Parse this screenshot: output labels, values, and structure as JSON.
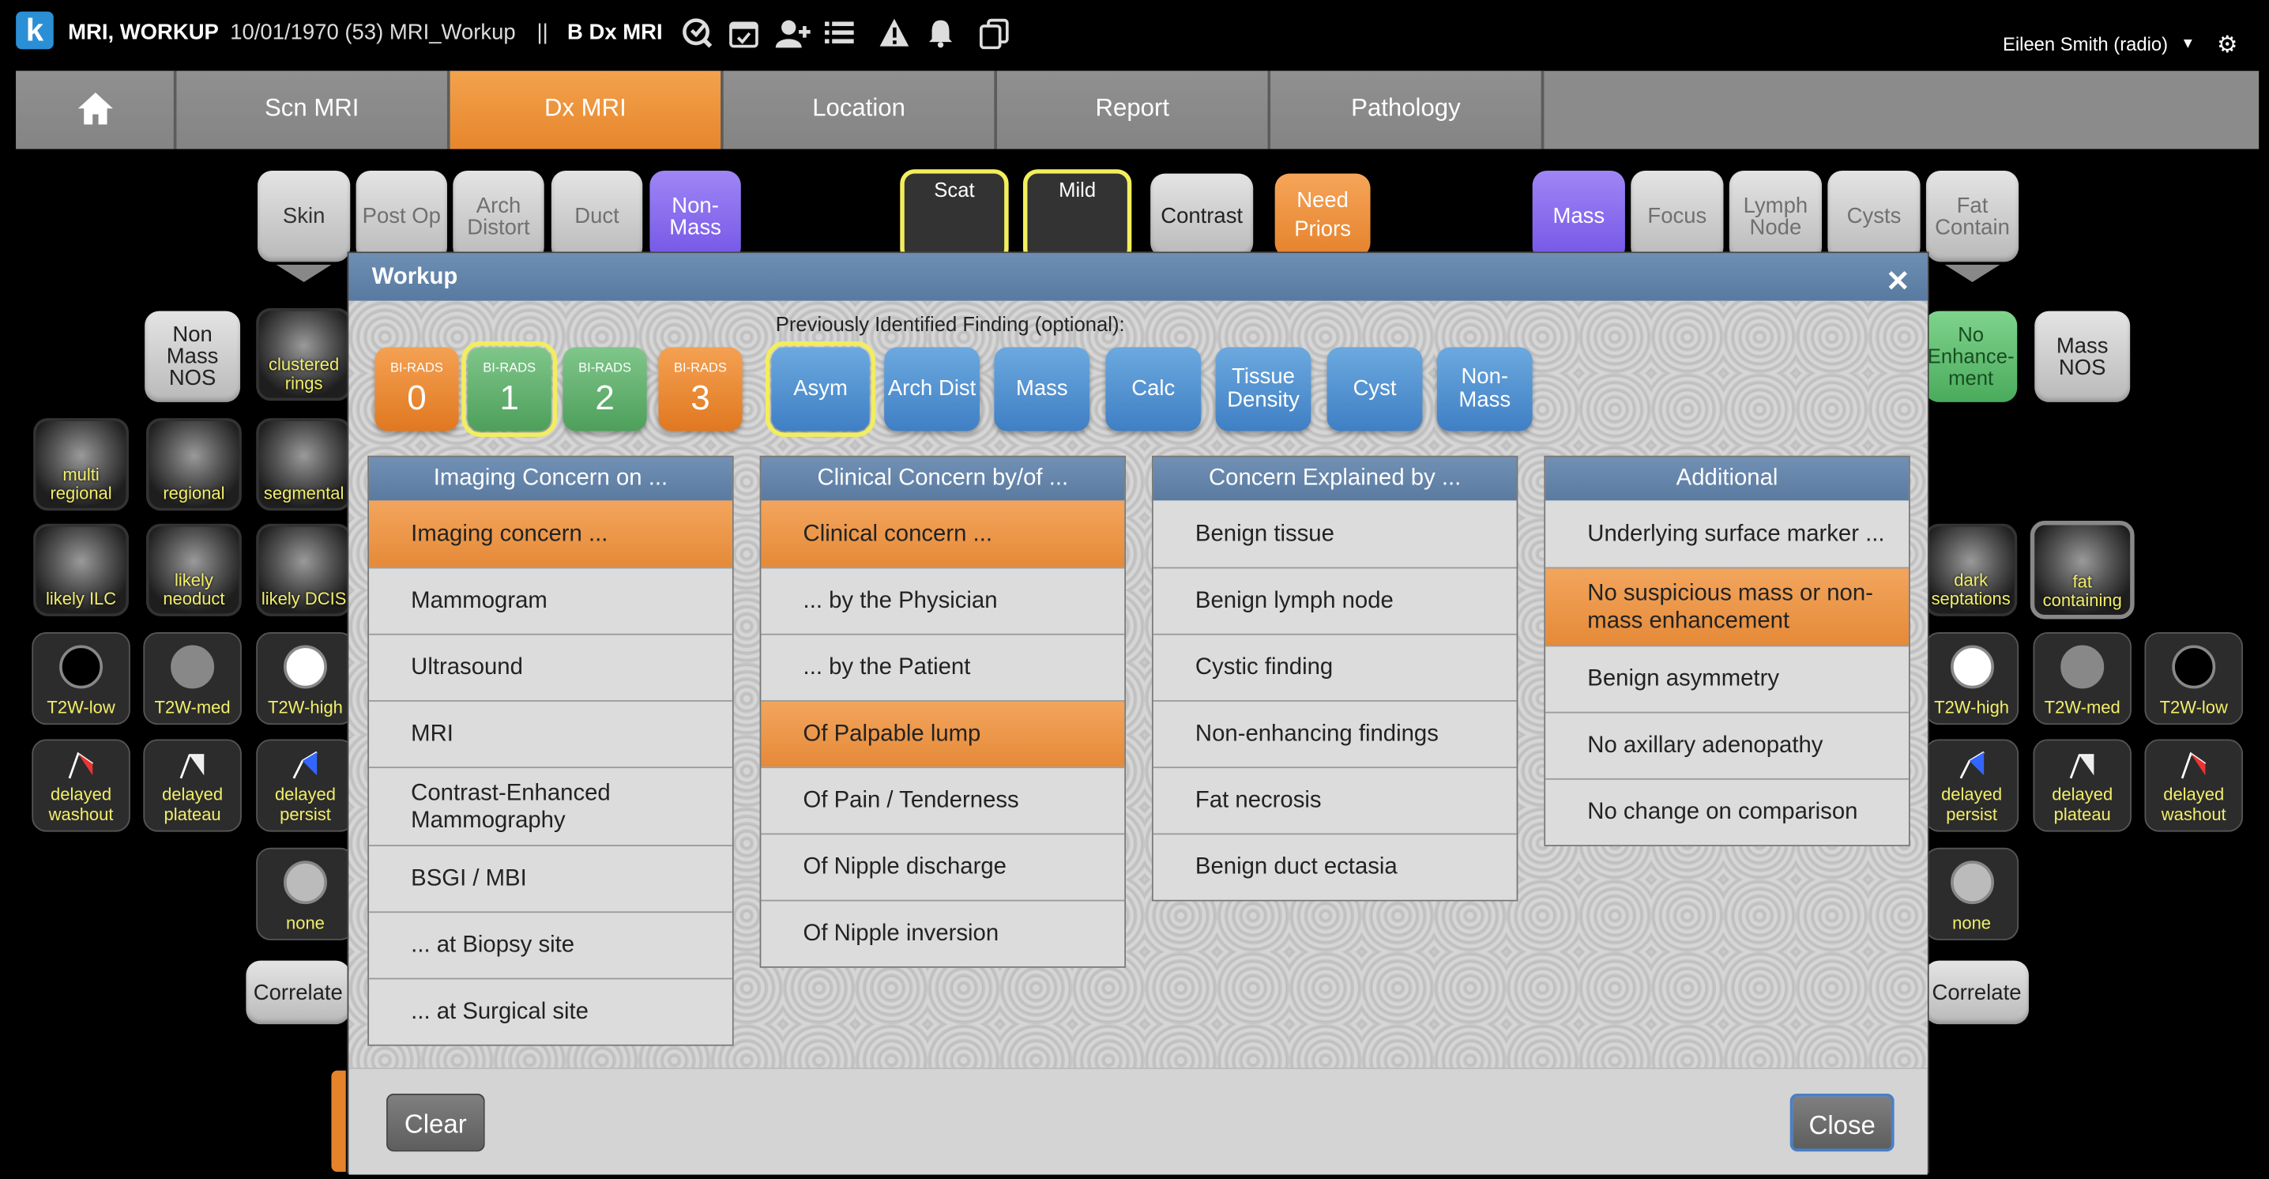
{
  "topbar": {
    "title_bold": "MRI, WORKUP",
    "title_rest": "10/01/1970 (53) MRI_Workup",
    "separator": "||",
    "module": "B Dx MRI",
    "user": "Eileen Smith (radio)",
    "logo": "k"
  },
  "nav": {
    "tabs": [
      "Scn MRI",
      "Dx MRI",
      "Location",
      "Report",
      "Pathology"
    ],
    "active": "Dx MRI"
  },
  "bg": {
    "top_left": [
      "Skin",
      "Post Op",
      "Arch Distort",
      "Duct",
      "Non-Mass"
    ],
    "top_mid": [
      "Scat",
      "Mild",
      "Contrast",
      "Need Priors"
    ],
    "top_right": [
      "Mass",
      "Focus",
      "Lymph Node",
      "Cysts",
      "Fat Contain"
    ],
    "left_nonmass": "Non Mass NOS",
    "left_thumbs": [
      "clustered rings",
      "multi regional",
      "regional",
      "segmental",
      "likely ILC",
      "likely neoduct",
      "likely DCIS"
    ],
    "left_t2": [
      "T2W-low",
      "T2W-med",
      "T2W-high"
    ],
    "left_kin": [
      "delayed washout",
      "delayed plateau",
      "delayed persist"
    ],
    "left_none": "none",
    "left_correlate": "Correlate",
    "right_no_enh": "No Enhance-ment",
    "right_mass_nos": "Mass NOS",
    "right_thumbs": [
      "dark septations",
      "fat containing"
    ],
    "right_t2": [
      "T2W-high",
      "T2W-med",
      "T2W-low"
    ],
    "right_kin": [
      "delayed persist",
      "delayed plateau",
      "delayed washout"
    ],
    "right_none": "none",
    "right_correlate": "Correlate"
  },
  "modal": {
    "title": "Workup",
    "prev_label": "Previously Identified Finding (optional):",
    "birads": [
      {
        "label": "BI-RADS",
        "num": "0"
      },
      {
        "label": "BI-RADS",
        "num": "1"
      },
      {
        "label": "BI-RADS",
        "num": "2"
      },
      {
        "label": "BI-RADS",
        "num": "3"
      }
    ],
    "findings": [
      "Asym",
      "Arch Dist",
      "Mass",
      "Calc",
      "Tissue Density",
      "Cyst",
      "Non-Mass"
    ],
    "columns": [
      {
        "header": "Imaging Concern on ...",
        "items": [
          "Imaging concern ...",
          "Mammogram",
          "Ultrasound",
          "MRI",
          "Contrast-Enhanced Mammography",
          "BSGI / MBI",
          "... at Biopsy site",
          "... at Surgical site"
        ]
      },
      {
        "header": "Clinical Concern by/of ...",
        "items": [
          "Clinical concern ...",
          "... by the Physician",
          "... by the Patient",
          "Of Palpable lump",
          "Of Pain / Tenderness",
          "Of Nipple discharge",
          "Of Nipple inversion"
        ]
      },
      {
        "header": "Concern Explained by ...",
        "items": [
          "Benign tissue",
          "Benign lymph node",
          "Cystic finding",
          "Non-enhancing findings",
          "Fat necrosis",
          "Benign duct ectasia"
        ]
      },
      {
        "header": "Additional",
        "items": [
          "Underlying surface marker ...",
          "No suspicious mass or non-mass enhancement",
          "Benign asymmetry",
          "No axillary adenopathy",
          "No change on comparison"
        ]
      }
    ],
    "clear": "Clear",
    "close": "Close"
  },
  "colors": {
    "accent_orange": "#e8882f",
    "panel_blue": "#5a7aa0",
    "finding_blue": "#4a88cc",
    "highlight_yellow": "#f2ee5e"
  }
}
